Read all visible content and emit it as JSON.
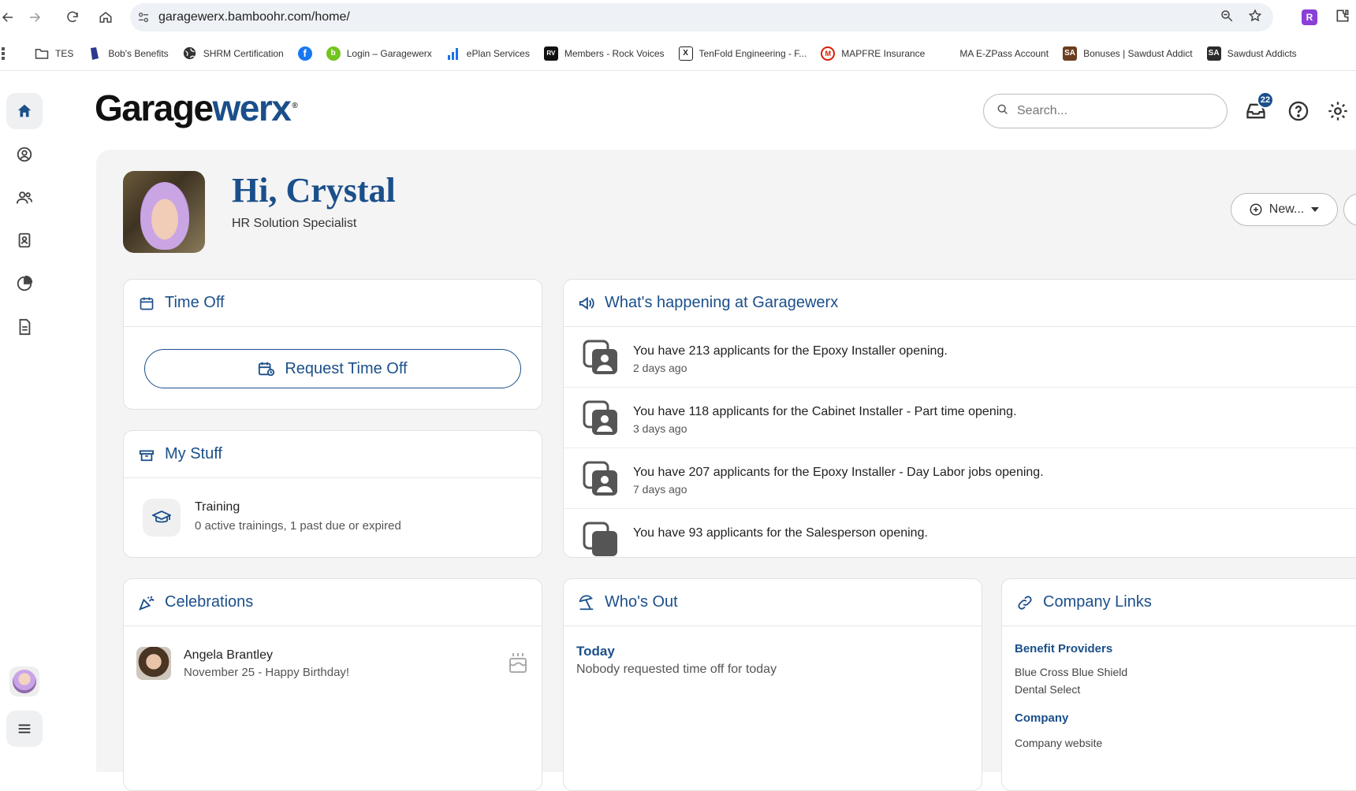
{
  "browser": {
    "url": "garagewerx.bamboohr.com/home/",
    "ext_badge": "R",
    "bookmarks": [
      {
        "label": "TES",
        "icon": "folder-icon"
      },
      {
        "label": "Bob's Benefits",
        "icon": "shield-icon",
        "color": "#2b3a8f"
      },
      {
        "label": "SHRM Certification",
        "icon": "globe-icon"
      },
      {
        "label": "",
        "icon": "facebook-icon",
        "color": "#1877f2"
      },
      {
        "label": "Login – Garagewerx",
        "icon": "bamboo-icon",
        "color": "#73c41d"
      },
      {
        "label": "ePlan Services",
        "icon": "bar-icon",
        "color": "#1a73e8"
      },
      {
        "label": "Members - Rock Voices",
        "icon": "rv-icon",
        "color": "#111111"
      },
      {
        "label": "TenFold Engineering - F...",
        "icon": "x-icon",
        "color": "#222222"
      },
      {
        "label": "MAPFRE Insurance",
        "icon": "mapfre-icon",
        "color": "#d81e05"
      },
      {
        "label": "MA E-ZPass Account",
        "icon": "blank-icon"
      },
      {
        "label": "Bonuses | Sawdust Addict",
        "icon": "sa-icon",
        "color": "#6b3d1f",
        "abbr": "SA"
      },
      {
        "label": "Sawdust Addicts",
        "icon": "sa-icon",
        "color": "#2a2a2a",
        "abbr": "SA"
      }
    ]
  },
  "header": {
    "logo_part1": "Garage",
    "logo_part2": "werx",
    "logo_reg": "®",
    "search_placeholder": "Search...",
    "notification_count": "22"
  },
  "profile": {
    "greeting": "Hi, Crystal",
    "job_title": "HR Solution Specialist",
    "new_label": "New..."
  },
  "time_off": {
    "title": "Time Off",
    "request_label": "Request Time Off"
  },
  "my_stuff": {
    "title": "My Stuff",
    "training_title": "Training",
    "training_sub": "0 active trainings, 1 past due or expired"
  },
  "happening": {
    "title": "What's happening at Garagewerx",
    "items": [
      {
        "text": "You have 213 applicants for the Epoxy Installer opening.",
        "time": "2 days ago"
      },
      {
        "text": "You have 118 applicants for the Cabinet Installer - Part time opening.",
        "time": "3 days ago"
      },
      {
        "text": "You have 207 applicants for the Epoxy Installer - Day Labor jobs opening.",
        "time": "7 days ago"
      },
      {
        "text": "You have 93 applicants for the Salesperson opening.",
        "time": ""
      }
    ]
  },
  "celebrations": {
    "title": "Celebrations",
    "name": "Angela Brantley",
    "detail": "November 25 - Happy Birthday!"
  },
  "whos_out": {
    "title": "Who's Out",
    "today_label": "Today",
    "today_text": "Nobody requested time off for today"
  },
  "company_links": {
    "title": "Company Links",
    "groups": [
      {
        "heading": "Benefit Providers",
        "links": [
          "Blue Cross Blue Shield",
          "Dental Select"
        ]
      },
      {
        "heading": "Company",
        "links": [
          "Company website"
        ]
      }
    ]
  },
  "colors": {
    "brand": "#1b4f8a",
    "panel_bg": "#f4f4f4"
  }
}
